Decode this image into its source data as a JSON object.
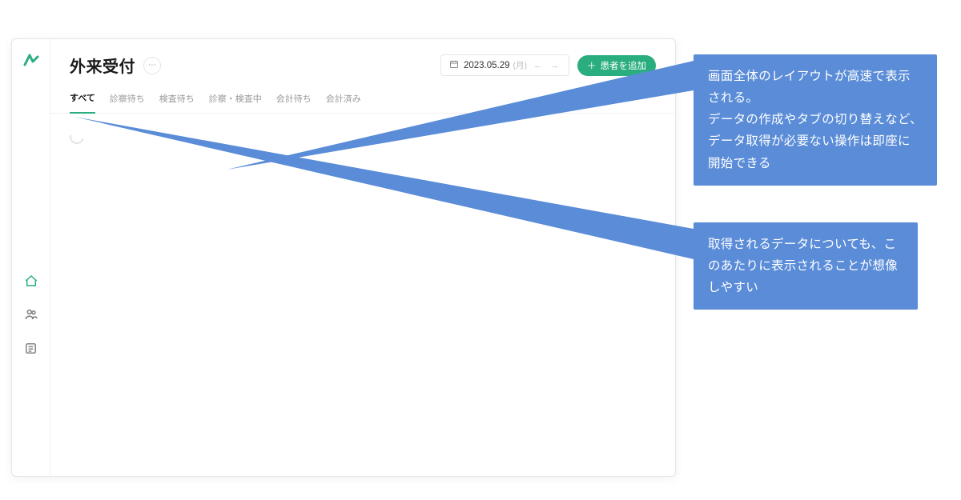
{
  "header": {
    "title": "外来受付",
    "date": "2023.05.29",
    "day_label": "(月)",
    "add_button_label": "患者を追加"
  },
  "tabs": [
    {
      "label": "すべて",
      "active": true
    },
    {
      "label": "診察待ち",
      "active": false
    },
    {
      "label": "検査待ち",
      "active": false
    },
    {
      "label": "診察・検査中",
      "active": false
    },
    {
      "label": "会計待ち",
      "active": false
    },
    {
      "label": "会計済み",
      "active": false
    }
  ],
  "callouts": {
    "c1": "画面全体のレイアウトが高速で表示される。\nデータの作成やタブの切り替えなど、データ取得が必要ない操作は即座に開始できる",
    "c2": "取得されるデータについても、このあたりに表示されることが想像しやすい"
  },
  "colors": {
    "accent": "#2aae7f",
    "callout": "#5a8cd8"
  }
}
